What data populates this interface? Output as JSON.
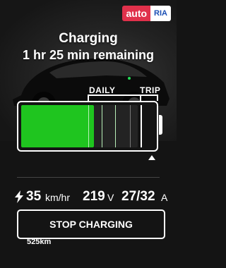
{
  "watermark": {
    "part_a": "auto",
    "part_b": "RIA"
  },
  "status": {
    "title": "Charging",
    "remaining": "1 hr 25 min remaining"
  },
  "battery": {
    "daily_label": "DAILY",
    "trip_label": "TRIP",
    "range": "525km",
    "charge_level_fraction": 0.55,
    "charge_limit_fraction": 0.88,
    "fill_color": "#1fc51f"
  },
  "stats": {
    "rate_value": "35",
    "rate_unit": "km/hr",
    "voltage_value": "219",
    "voltage_unit": "V",
    "current_value": "27/32",
    "current_unit": "A"
  },
  "actions": {
    "stop_label": "STOP CHARGING"
  }
}
